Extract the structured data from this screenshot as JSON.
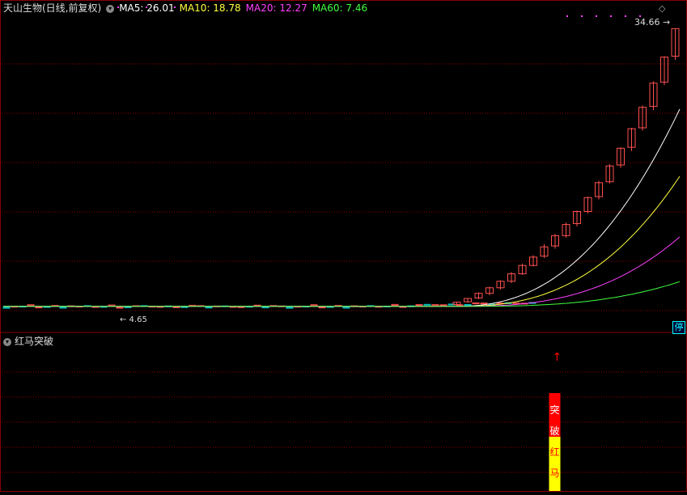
{
  "header": {
    "title": "天山生物(日线,前复权)",
    "ma5": "MA5: 26.01",
    "ma10": "MA10: 18.78",
    "ma20": "MA20: 12.27",
    "ma60": "MA60: 7.46"
  },
  "price_labels": {
    "high": "34.66",
    "low": "4.65"
  },
  "stop_tag": "停",
  "indicator": {
    "name": "红马突破",
    "bar_chars": [
      "突",
      "破",
      "红",
      "马"
    ]
  },
  "colors": {
    "up": "#ff5050",
    "down": "#00c0c0",
    "ma5": "#ffffff",
    "ma10": "#ffff40",
    "ma20": "#ff40ff",
    "ma60": "#40ff40",
    "grid": "#8b0000",
    "signal_top": "#ff0000",
    "signal_bottom": "#ffff00"
  },
  "chart_data": {
    "type": "candlestick",
    "title": "天山生物(日线,前复权)",
    "ylim": [
      4.0,
      36.0
    ],
    "series": [
      {
        "name": "MA5",
        "value": 26.01
      },
      {
        "name": "MA10",
        "value": 18.78
      },
      {
        "name": "MA20",
        "value": 12.27
      },
      {
        "name": "MA60",
        "value": 7.46
      }
    ],
    "recent_candles": [
      {
        "o": 5.0,
        "h": 5.3,
        "l": 4.9,
        "c": 5.25
      },
      {
        "o": 5.3,
        "h": 5.7,
        "l": 5.2,
        "c": 5.65
      },
      {
        "o": 5.7,
        "h": 6.3,
        "l": 5.6,
        "c": 6.2
      },
      {
        "o": 6.2,
        "h": 6.9,
        "l": 6.0,
        "c": 6.8
      },
      {
        "o": 6.8,
        "h": 7.6,
        "l": 6.6,
        "c": 7.5
      },
      {
        "o": 7.5,
        "h": 8.5,
        "l": 7.3,
        "c": 8.3
      },
      {
        "o": 8.3,
        "h": 9.4,
        "l": 8.2,
        "c": 9.2
      },
      {
        "o": 9.2,
        "h": 10.3,
        "l": 9.1,
        "c": 10.1
      },
      {
        "o": 10.2,
        "h": 11.5,
        "l": 10.0,
        "c": 11.2
      },
      {
        "o": 11.3,
        "h": 12.6,
        "l": 11.0,
        "c": 12.4
      },
      {
        "o": 12.4,
        "h": 13.8,
        "l": 12.2,
        "c": 13.6
      },
      {
        "o": 13.7,
        "h": 15.1,
        "l": 13.4,
        "c": 15.0
      },
      {
        "o": 15.0,
        "h": 16.6,
        "l": 14.8,
        "c": 16.5
      },
      {
        "o": 16.6,
        "h": 18.3,
        "l": 16.3,
        "c": 18.1
      },
      {
        "o": 18.2,
        "h": 20.1,
        "l": 18.0,
        "c": 19.9
      },
      {
        "o": 20.0,
        "h": 21.9,
        "l": 19.7,
        "c": 21.8
      },
      {
        "o": 21.9,
        "h": 24.0,
        "l": 21.5,
        "c": 23.9
      },
      {
        "o": 24.0,
        "h": 26.4,
        "l": 23.7,
        "c": 26.2
      },
      {
        "o": 26.3,
        "h": 29.0,
        "l": 25.9,
        "c": 28.8
      },
      {
        "o": 28.9,
        "h": 31.7,
        "l": 28.6,
        "c": 31.6
      },
      {
        "o": 31.7,
        "h": 34.66,
        "l": 31.3,
        "c": 34.66
      }
    ],
    "signal_index": 9
  }
}
